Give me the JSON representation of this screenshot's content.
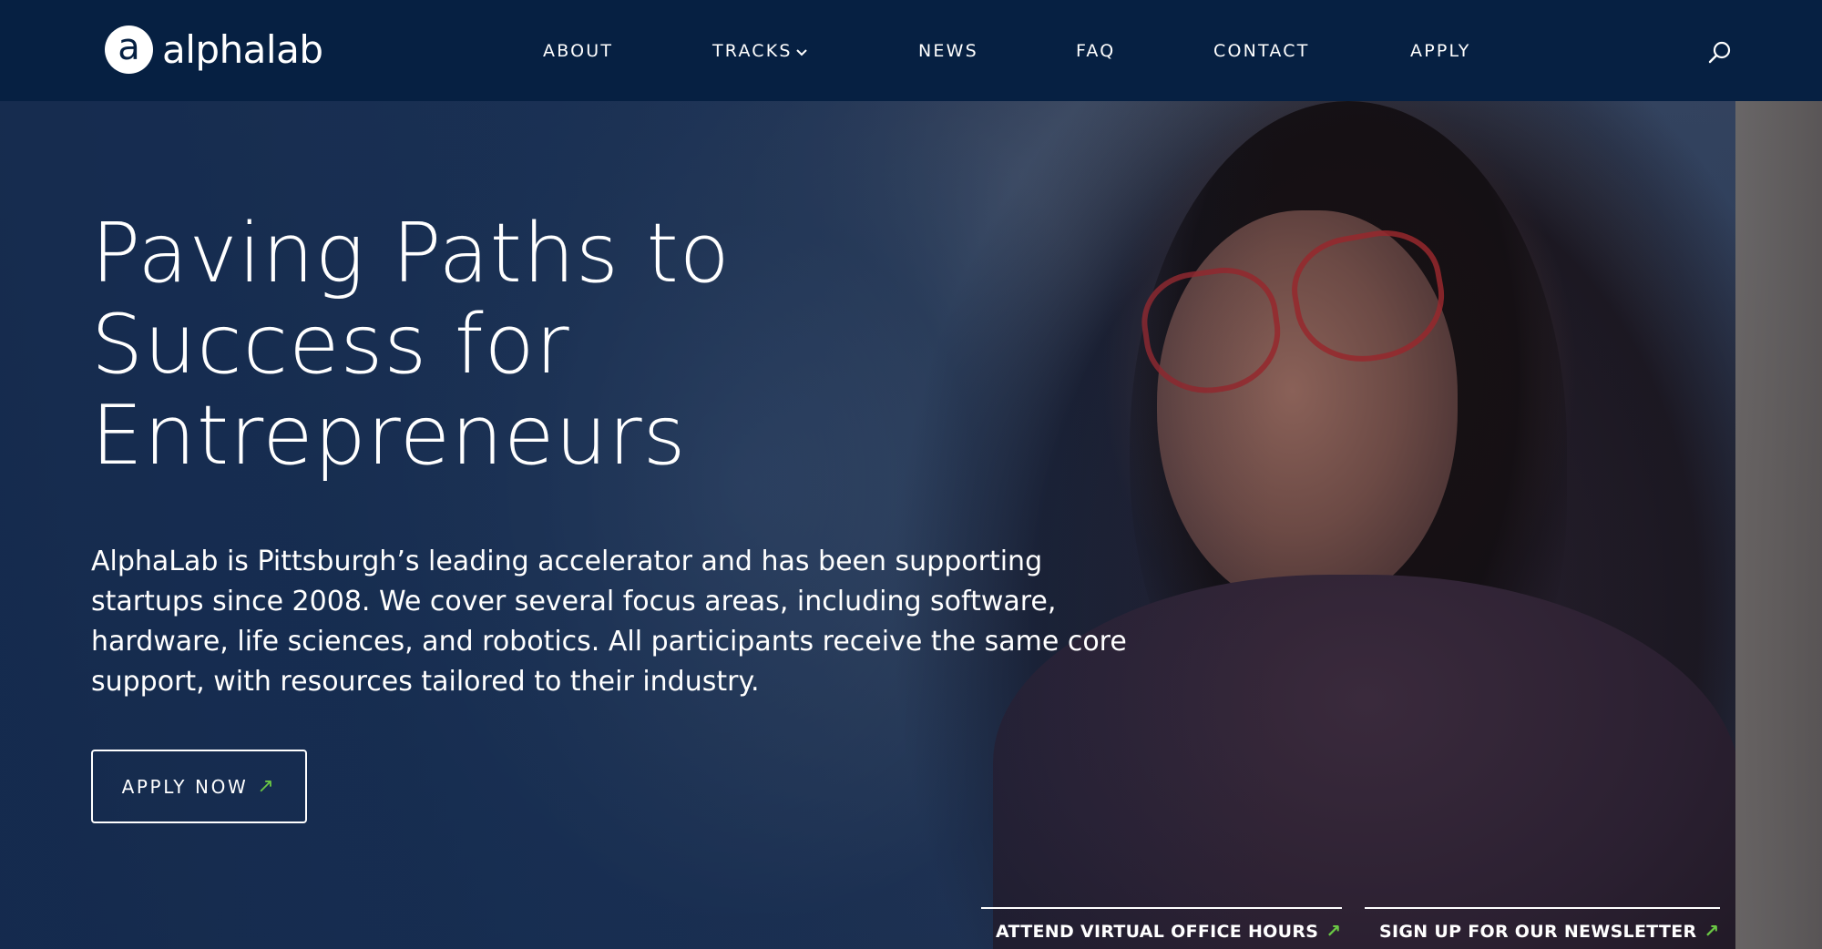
{
  "brand": {
    "logo_mark": "a",
    "name": "alphalab"
  },
  "nav": {
    "items": [
      {
        "label": "ABOUT"
      },
      {
        "label": "TRACKS"
      },
      {
        "label": "NEWS"
      },
      {
        "label": "FAQ"
      },
      {
        "label": "CONTACT"
      },
      {
        "label": "APPLY"
      }
    ],
    "tracks_icon": "chevron-down-icon",
    "search_icon": "search-icon"
  },
  "hero": {
    "headline_lines": [
      "Paving Paths to",
      "Success for",
      "Entrepreneurs"
    ],
    "intro": "AlphaLab is Pittsburgh’s leading accelerator and has been supporting startups since 2008. We cover several focus areas, including software, hardware, life sciences, and robotics. All participants receive the same core support, with resources tailored to their industry.",
    "apply_button": "APPLY NOW",
    "arrow_glyph": "↗"
  },
  "ctas": [
    {
      "label": "ATTEND VIRTUAL OFFICE HOURS"
    },
    {
      "label": "SIGN UP FOR OUR NEWSLETTER"
    }
  ],
  "colors": {
    "header_bg": "#062042",
    "accent_arrow": "#6ac744",
    "text": "#ffffff"
  }
}
